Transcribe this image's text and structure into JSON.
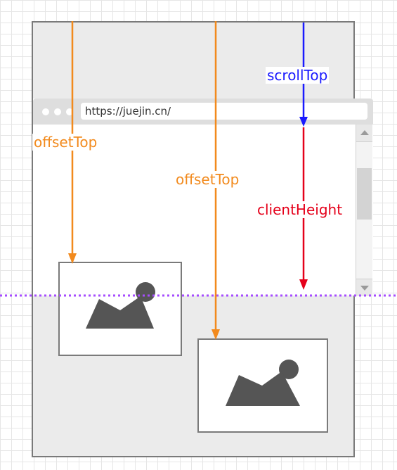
{
  "browser": {
    "url": "https://juejin.cn/"
  },
  "labels": {
    "offset_top_1": "offsetTop",
    "offset_top_2": "offsetTop",
    "scroll_top": "scrollTop",
    "client_height": "clientHeight"
  },
  "colors": {
    "offset_top": "#f28a1d",
    "scroll_top": "#1a1aff",
    "client_height": "#e5001a",
    "viewport_bottom_line": "#a64dff",
    "image_icon": "#555555"
  },
  "icons": {
    "image_placeholder": "image-icon",
    "window_controls": "dots-icon"
  }
}
